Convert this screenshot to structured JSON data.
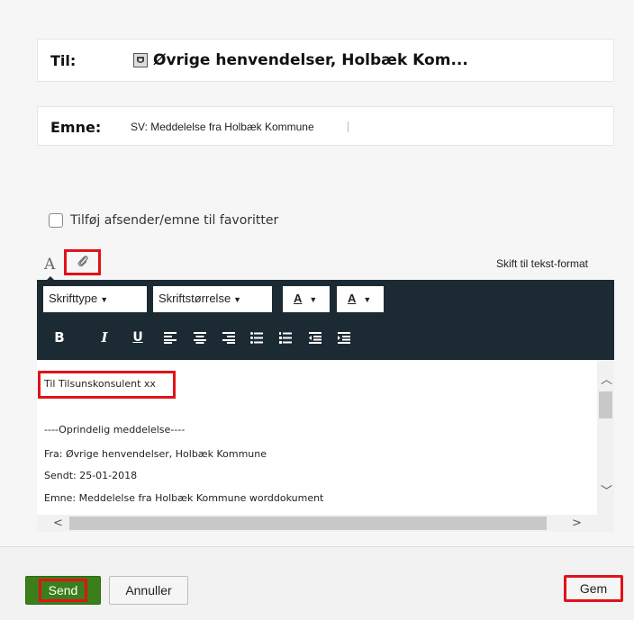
{
  "to": {
    "label": "Til:",
    "recipient": "Øvrige henvendelser, Holbæk Kom..."
  },
  "subject": {
    "label": "Emne:",
    "value": "SV: Meddelelse fra Holbæk Kommune"
  },
  "favorite": {
    "label": "Tilføj afsender/emne til favoritter",
    "checked": false
  },
  "format_bar": {
    "text_icon": "A",
    "switch_label": "Skift til tekst-format"
  },
  "toolbar": {
    "font_dropdown": "Skrifttype",
    "size_dropdown": "Skriftstørrelse",
    "text_color_label": "A",
    "bg_color_label": "A",
    "bold": "B",
    "italic": "I",
    "underline": "U"
  },
  "editor": {
    "lines": [
      "Til Tilsunskonsulent xx",
      "----Oprindelig meddelelse----",
      "Fra: Øvrige henvendelser, Holbæk Kommune",
      "Sendt: 25-01-2018",
      "Emne: Meddelelse fra Holbæk Kommune worddokument"
    ]
  },
  "footer": {
    "send_label": "Send",
    "cancel_label": "Annuller",
    "save_label": "Gem"
  },
  "colors": {
    "toolbar_bg": "#1c2a33",
    "send_green": "#3a7f1a",
    "highlight_red": "#e0121a"
  }
}
